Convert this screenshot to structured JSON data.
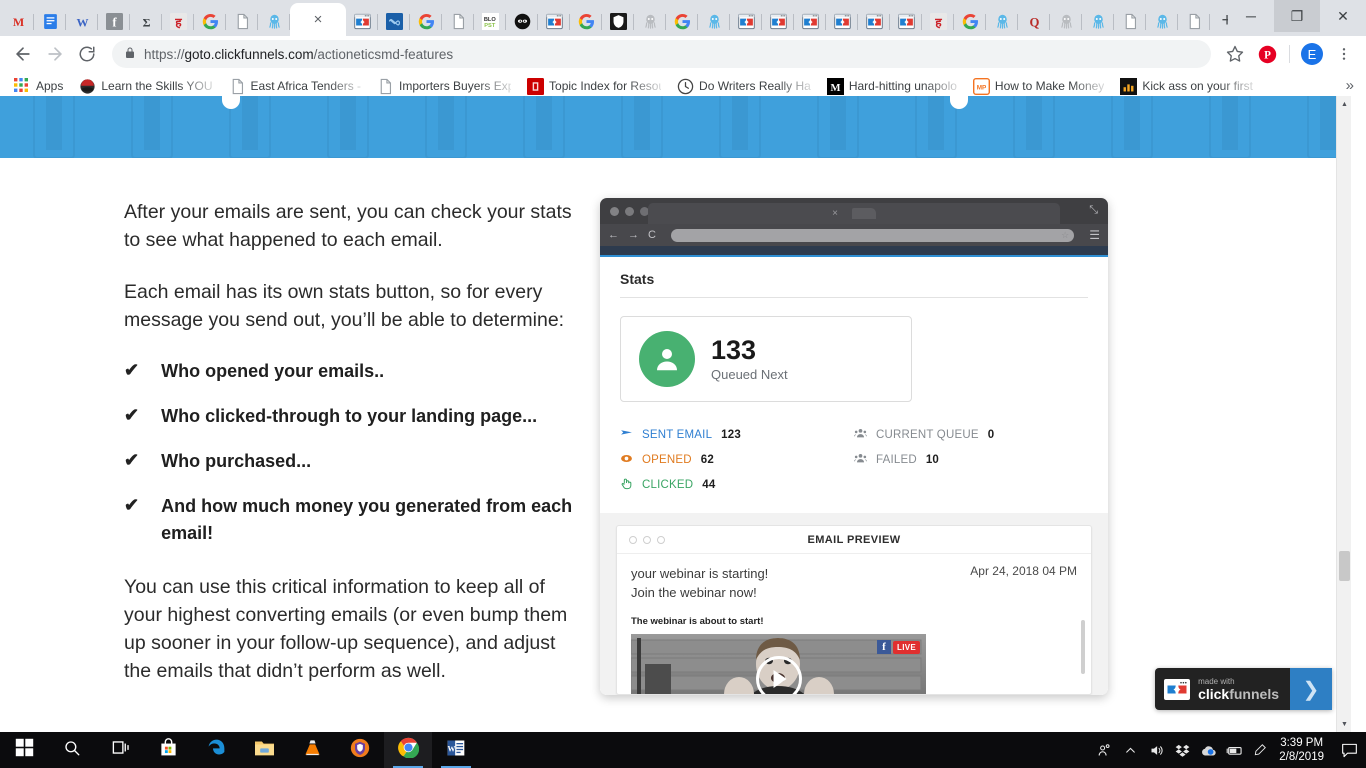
{
  "browser": {
    "tabs": [
      {
        "name": "gmail-tab",
        "icon": "gmail-icon"
      },
      {
        "name": "google-docs-tab",
        "icon": "docs-icon"
      },
      {
        "name": "wikipedia-tab",
        "icon": "w-icon"
      },
      {
        "name": "facebook-tab",
        "icon": "facebook-icon"
      },
      {
        "name": "sigma-tab",
        "icon": "sigma-icon"
      },
      {
        "name": "grammarly-tab",
        "icon": "grammarly-icon"
      },
      {
        "name": "google-tab",
        "icon": "google-icon"
      },
      {
        "name": "document-tab",
        "icon": "page-icon"
      },
      {
        "name": "octopus-tab",
        "icon": "octopus-icon"
      }
    ],
    "active_tab": {
      "name": "clickfunnels-tab",
      "close_label": "×"
    },
    "tabs_after": [
      {
        "name": "clickfunnels-tab-2",
        "icon": "cf-icon"
      },
      {
        "name": "infinity-tab",
        "icon": "infinity-icon"
      },
      {
        "name": "google-tab-2",
        "icon": "google-icon"
      },
      {
        "name": "document-tab-2",
        "icon": "page-icon"
      },
      {
        "name": "blog-tab",
        "icon": "blog-icon"
      },
      {
        "name": "ninja-tab",
        "icon": "ninja-icon"
      },
      {
        "name": "clickfunnels-tab-3",
        "icon": "cf-icon"
      },
      {
        "name": "google-tab-3",
        "icon": "google-icon"
      },
      {
        "name": "shield-tab",
        "icon": "shield-icon"
      },
      {
        "name": "octopus-tab-2",
        "icon": "octopus-icon"
      },
      {
        "name": "google-tab-4",
        "icon": "google-icon"
      },
      {
        "name": "octopus-tab-3",
        "icon": "octopus-icon"
      },
      {
        "name": "clickfunnels-tab-4",
        "icon": "cf-icon"
      },
      {
        "name": "clickfunnels-tab-5",
        "icon": "cf-icon"
      },
      {
        "name": "clickfunnels-tab-6",
        "icon": "cf-icon"
      },
      {
        "name": "clickfunnels-tab-7",
        "icon": "cf-icon"
      },
      {
        "name": "clickfunnels-tab-8",
        "icon": "cf-icon"
      },
      {
        "name": "clickfunnels-tab-9",
        "icon": "cf-icon"
      },
      {
        "name": "grammarly-tab-2",
        "icon": "grammarly-icon"
      },
      {
        "name": "google-tab-5",
        "icon": "google-icon"
      },
      {
        "name": "octopus-tab-4",
        "icon": "octopus-icon"
      },
      {
        "name": "quora-tab",
        "icon": "quora-icon"
      },
      {
        "name": "octopus-tab-5",
        "icon": "octopus-icon"
      },
      {
        "name": "octopus-tab-6",
        "icon": "octopus-icon"
      },
      {
        "name": "document-tab-3",
        "icon": "page-icon"
      },
      {
        "name": "octopus-tab-7",
        "icon": "octopus-icon"
      },
      {
        "name": "document-tab-4",
        "icon": "page-icon"
      }
    ],
    "new_tab_label": "+",
    "window_controls": {
      "minimize": "─",
      "restore": "❐",
      "close": "✕"
    },
    "nav": {
      "back": "←",
      "forward": "→",
      "reload": "⟳"
    },
    "url": {
      "scheme": "https://",
      "host": "goto.clickfunnels.com",
      "path": "/actioneticsmd-features"
    },
    "profile_initial": "E",
    "bookmarks": {
      "apps_label": "Apps",
      "items": [
        {
          "label": "Learn the Skills YOU ",
          "icon": "helmet-icon"
        },
        {
          "label": "East Africa Tenders - ",
          "icon": "page-icon"
        },
        {
          "label": "Importers Buyers Exp",
          "icon": "page-icon"
        },
        {
          "label": "Topic Index for Resou",
          "icon": "red-square-icon"
        },
        {
          "label": "Do Writers Really Ha",
          "icon": "clock-icon"
        },
        {
          "label": "Hard-hitting unapolo",
          "icon": "medium-icon"
        },
        {
          "label": "How to Make Money",
          "icon": "mp-icon"
        },
        {
          "label": "Kick ass on your first",
          "icon": "bar-icon"
        }
      ],
      "overflow_label": "»"
    }
  },
  "page": {
    "paragraph_1": "After your emails are sent, you can check your stats to see what happened to each email.",
    "paragraph_2": "Each email has its own stats button, so for every message you send out, you’ll be able to determine:",
    "bullets": [
      {
        "check": "✔",
        "text": "Who opened your emails.."
      },
      {
        "check": "✔",
        "text": "Who clicked-through to your landing page..."
      },
      {
        "check": "✔",
        "text": "Who purchased..."
      },
      {
        "check": "✔",
        "text": "And how much money you generated from each email!"
      }
    ],
    "paragraph_3": "You can use this critical information to keep all of your highest converting emails (or even bump them up sooner in your follow-up sequence), and adjust the emails that didn’t perform as well.",
    "mockup": {
      "tab_close": "×",
      "expand": "⤡",
      "nav": {
        "back": "←",
        "forward": "→",
        "reload": "C"
      },
      "star": "☆",
      "menu": "☰",
      "stats_heading": "Stats",
      "queued": {
        "number": "133",
        "label": "Queued Next"
      },
      "stats_left": [
        {
          "icon": "send-icon",
          "label": "SENT EMAIL",
          "value": "123",
          "color": "#2f7fd1"
        },
        {
          "icon": "eye-icon",
          "label": "OPENED",
          "value": "62",
          "color": "#e07b20"
        },
        {
          "icon": "click-icon",
          "label": "CLICKED",
          "value": "44",
          "color": "#3aa564"
        }
      ],
      "stats_right": [
        {
          "icon": "people-icon",
          "label": "CURRENT QUEUE",
          "value": "0",
          "color": "#868b90"
        },
        {
          "icon": "people-icon",
          "label": "FAILED",
          "value": "10",
          "color": "#868b90"
        }
      ],
      "email_preview": {
        "title": "EMAIL PREVIEW",
        "subject_line_1": "your webinar is starting!",
        "subject_line_2": "Join the webinar now!",
        "date": "Apr 24, 2018 04 PM",
        "body_heading": "The webinar is about to start!",
        "live_badge": "LIVE",
        "fb_badge": "f"
      }
    },
    "clickfunnels_badge": {
      "made_with": "made with",
      "brand_click": "click",
      "brand_funnels": "funnels",
      "arrow": "❯"
    }
  },
  "taskbar": {
    "items": [
      {
        "name": "start-button",
        "icon": "windows-icon"
      },
      {
        "name": "search-button",
        "icon": "search-icon"
      },
      {
        "name": "task-view-button",
        "icon": "taskview-icon"
      },
      {
        "name": "microsoft-store",
        "icon": "store-icon"
      },
      {
        "name": "edge-browser",
        "icon": "edge-icon"
      },
      {
        "name": "file-explorer",
        "icon": "folder-icon"
      },
      {
        "name": "vlc-player",
        "icon": "vlc-icon"
      },
      {
        "name": "avast-antivirus",
        "icon": "shield-icon"
      },
      {
        "name": "google-chrome",
        "icon": "chrome-icon"
      },
      {
        "name": "microsoft-word",
        "icon": "word-icon"
      }
    ],
    "tray": [
      {
        "name": "people-icon"
      },
      {
        "name": "chevron-up-icon"
      },
      {
        "name": "volume-icon"
      },
      {
        "name": "dropbox-icon"
      },
      {
        "name": "onedrive-icon"
      },
      {
        "name": "battery-icon"
      },
      {
        "name": "pen-icon"
      }
    ],
    "time": "3:39 PM",
    "date": "2/8/2019",
    "notification_icon": "notification-icon"
  },
  "colors": {
    "hero_blue": "#3fa0dc",
    "accent_green": "#48b171",
    "cf_blue": "#2e7fc4"
  }
}
